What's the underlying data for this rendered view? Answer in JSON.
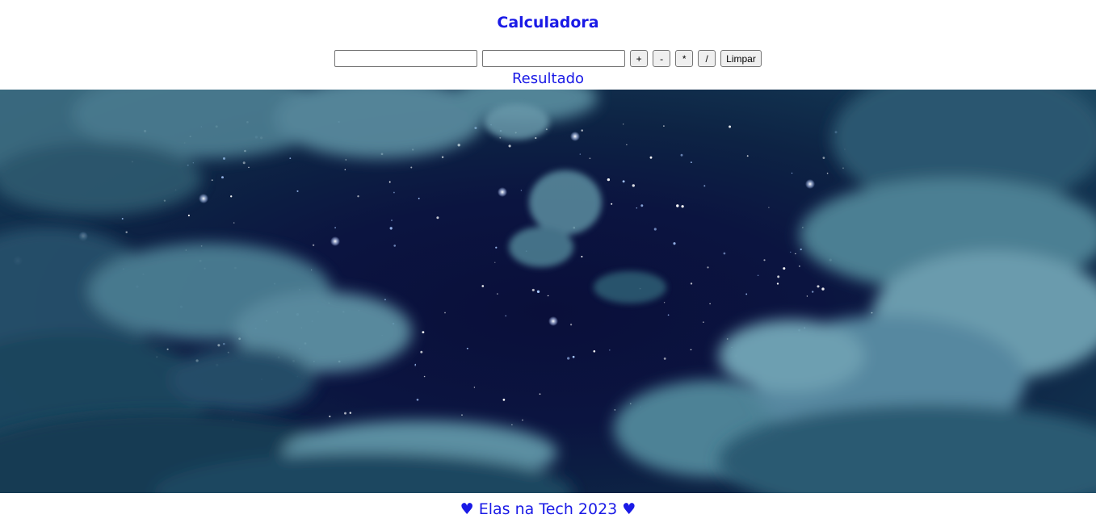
{
  "app": {
    "title": "Calculadora"
  },
  "calculator": {
    "input_a": {
      "value": "",
      "placeholder": ""
    },
    "input_b": {
      "value": "",
      "placeholder": ""
    },
    "buttons": {
      "add": "+",
      "subtract": "-",
      "multiply": "*",
      "divide": "/",
      "clear": "Limpar"
    },
    "result_text": "Resultado"
  },
  "footer": {
    "text": "♥ Elas na Tech 2023 ♥"
  },
  "colors": {
    "text_accent": "#1a1ae6",
    "background": "#ffffff",
    "sky_dark": "#0a0f3a",
    "cloud": "#6f9fb0"
  }
}
